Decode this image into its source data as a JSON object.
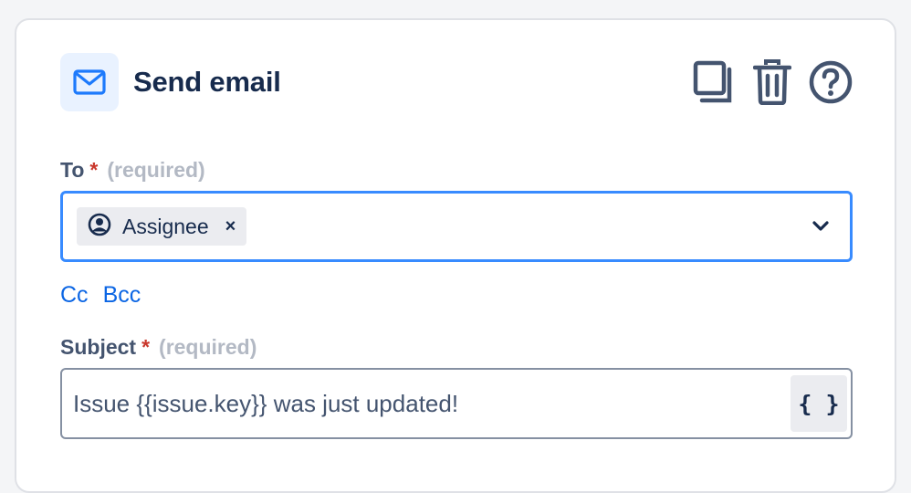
{
  "header": {
    "title": "Send email",
    "icons": [
      "mail-icon",
      "duplicate-icon",
      "trash-icon",
      "help-icon"
    ]
  },
  "to_field": {
    "label": "To",
    "required_star": "*",
    "required_hint": "(required)",
    "chips": [
      {
        "label": "Assignee",
        "icon": "user-circle-icon",
        "remove": "×"
      }
    ]
  },
  "links": {
    "cc": "Cc",
    "bcc": "Bcc"
  },
  "subject_field": {
    "label": "Subject",
    "required_star": "*",
    "required_hint": "(required)",
    "value": "Issue {{issue.key}} was just updated!",
    "variable_button": "{ }"
  },
  "colors": {
    "accent": "#0C66E4",
    "focus_border": "#388BFF",
    "required": "#C9372C",
    "text": "#172B4D"
  }
}
